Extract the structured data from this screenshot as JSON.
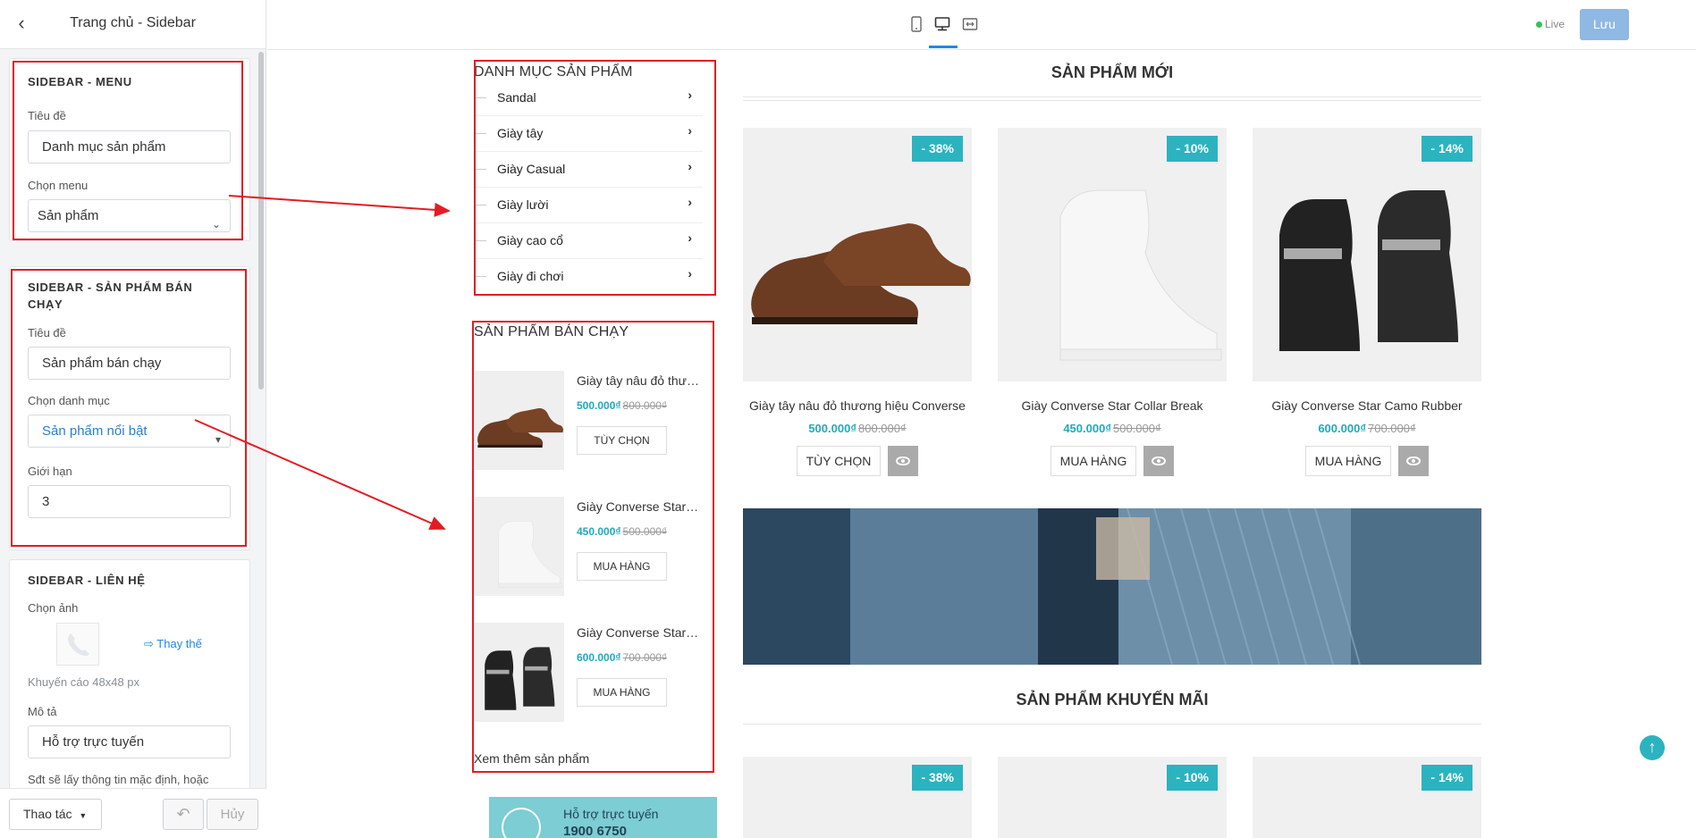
{
  "editor": {
    "title": "Trang chủ - Sidebar",
    "menu_panel": {
      "heading": "SIDEBAR - MENU",
      "title_label": "Tiêu đề",
      "title_value": "Danh mục sản phẩm",
      "menu_label": "Chọn menu",
      "menu_value": "Sản phẩm"
    },
    "bestseller_panel": {
      "heading_line1": "SIDEBAR - SẢN PHẨM BÁN",
      "heading_line2": "CHẠY",
      "title_label": "Tiêu đề",
      "title_value": "Sản phẩm bán chạy",
      "category_label": "Chọn danh mục",
      "category_value": "Sản phẩm nổi bật",
      "limit_label": "Giới hạn",
      "limit_value": "3"
    },
    "contact_panel": {
      "heading": "SIDEBAR - LIÊN HỆ",
      "image_label": "Chọn ảnh",
      "replace_label": "Thay thế",
      "hint": "Khuyến cáo 48x48 px",
      "desc_label": "Mô tả",
      "desc_value": "Hỗ trợ trực tuyến",
      "phone_note": "Sđt sẽ lấy thông tin mặc định, hoặc"
    },
    "footer": {
      "actions_label": "Thao tác",
      "cancel_label": "Hủy"
    }
  },
  "toolbar": {
    "live_label": "Live",
    "save_label": "Lưu"
  },
  "preview": {
    "category": {
      "title": "DANH MỤC SẢN PHẨM",
      "items": [
        "Sandal",
        "Giày tây",
        "Giày Casual",
        "Giày lười",
        "Giày cao cổ",
        "Giày đi chơi"
      ]
    },
    "bestseller": {
      "title": "SẢN PHẨM BÁN CHẠY",
      "items": [
        {
          "name": "Giày tây nâu đỏ thương hiệu Converse",
          "price": "500.000₫",
          "old_price": "800.000₫",
          "button": "TÙY CHỌN"
        },
        {
          "name": "Giày Converse Star Collar Break",
          "price": "450.000₫",
          "old_price": "500.000₫",
          "button": "MUA HÀNG"
        },
        {
          "name": "Giày Converse Star Camo Rubber",
          "price": "600.000₫",
          "old_price": "700.000₫",
          "button": "MUA HÀNG"
        }
      ],
      "more_link": "Xem thêm sản phẩm"
    },
    "contact_banner": {
      "label": "Hỗ trợ trực tuyến",
      "phone": "1900 6750"
    },
    "new_products": {
      "title": "SẢN PHẨM MỚI",
      "items": [
        {
          "badge": "- 38%",
          "name": "Giày tây nâu đỏ thương hiệu Converse",
          "price": "500.000₫",
          "old_price": "800.000₫",
          "button": "TÙY CHỌN"
        },
        {
          "badge": "- 10%",
          "name": "Giày Converse Star Collar Break",
          "price": "450.000₫",
          "old_price": "500.000₫",
          "button": "MUA HÀNG"
        },
        {
          "badge": "- 14%",
          "name": "Giày Converse Star Camo Rubber",
          "price": "600.000₫",
          "old_price": "700.000₫",
          "button": "MUA HÀNG"
        }
      ]
    },
    "promo_products": {
      "title": "SẢN PHẨM KHUYẾN MÃI",
      "badges": [
        "- 38%",
        "- 10%",
        "- 14%"
      ]
    }
  },
  "colors": {
    "accent": "#2bb3c0",
    "price": "#21a9bd",
    "annotation": "#e31c23",
    "save_button": "#8fb8e3",
    "live_dot": "#38c15a"
  }
}
